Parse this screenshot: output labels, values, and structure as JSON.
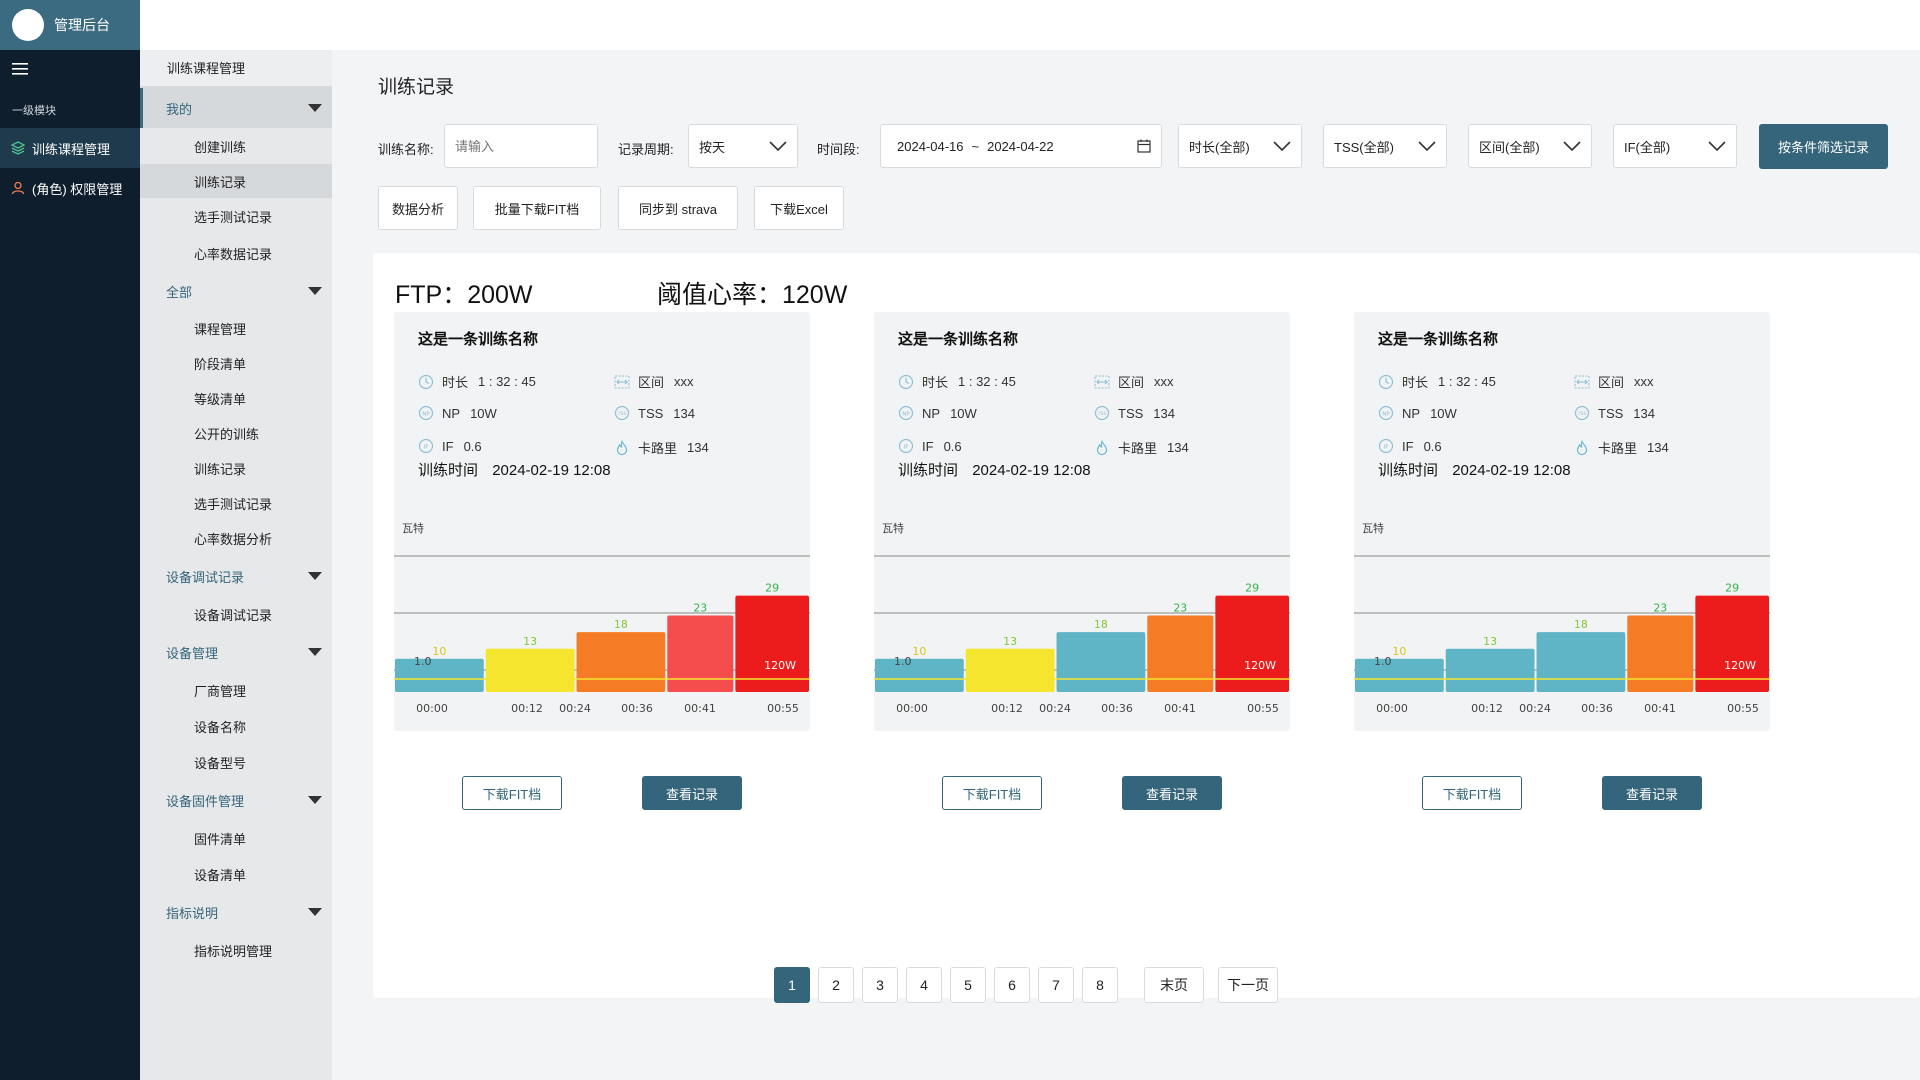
{
  "app": {
    "title": "管理后台"
  },
  "rail": {
    "section_label": "一级模块",
    "items": [
      {
        "label": "训练课程管理",
        "icon": "layers-icon",
        "active": true
      },
      {
        "label": "(角色) 权限管理",
        "icon": "user-icon",
        "active": false
      }
    ]
  },
  "submenu": {
    "header": "训练课程管理",
    "groups": [
      {
        "label": "我的",
        "items": [
          "创建训练",
          "训练记录",
          "选手测试记录",
          "心率数据记录"
        ]
      },
      {
        "label": "全部",
        "items": [
          "课程管理",
          "阶段清单",
          "等级清单",
          "公开的训练",
          "训练记录",
          "选手测试记录",
          "心率数据分析"
        ]
      },
      {
        "label": "设备调试记录",
        "items": [
          "设备调试记录"
        ]
      },
      {
        "label": "设备管理",
        "items": [
          "厂商管理",
          "设备名称",
          "设备型号"
        ]
      },
      {
        "label": "设备固件管理",
        "items": [
          "固件清单",
          "设备清单"
        ]
      },
      {
        "label": "指标说明",
        "items": [
          "指标说明管理"
        ]
      }
    ]
  },
  "page": {
    "title": "训练记录"
  },
  "filters": {
    "name_label": "训练名称:",
    "name_placeholder": "请输入",
    "period_label": "记录周期:",
    "period_value": "按天",
    "range_label": "时间段:",
    "range_start": "2024-04-16",
    "range_sep": "~",
    "range_end": "2024-04-22",
    "duration": "时长(全部)",
    "tss": "TSS(全部)",
    "zone": "区间(全部)",
    "if": "IF(全部)",
    "submit": "按条件筛选记录"
  },
  "actions": [
    "数据分析",
    "批量下载FIT档",
    "同步到 strava",
    "下载Excel"
  ],
  "summary": {
    "ftp": "FTP：200W",
    "hr_threshold": "阈值心率：120W"
  },
  "cards": [
    {
      "title": "这是一条训练名称",
      "duration_label": "时长",
      "duration": "1 : 32 : 45",
      "zone_label": "区间",
      "zone": "xxx",
      "np_label": "NP",
      "np": "10W",
      "tss_label": "TSS",
      "tss": "134",
      "if_label": "IF",
      "if": "0.6",
      "cal_label": "卡路里",
      "cal": "134",
      "time_label": "训练时间",
      "time": "2024-02-19  12:08",
      "unit": "瓦特",
      "btn_download": "下载FIT档",
      "btn_view": "查看记录"
    },
    {
      "title": "这是一条训练名称",
      "duration_label": "时长",
      "duration": "1 : 32 : 45",
      "zone_label": "区间",
      "zone": "xxx",
      "np_label": "NP",
      "np": "10W",
      "tss_label": "TSS",
      "tss": "134",
      "if_label": "IF",
      "if": "0.6",
      "cal_label": "卡路里",
      "cal": "134",
      "time_label": "训练时间",
      "time": "2024-02-19  12:08",
      "unit": "瓦特",
      "btn_download": "下载FIT档",
      "btn_view": "查看记录"
    },
    {
      "title": "这是一条训练名称",
      "duration_label": "时长",
      "duration": "1 : 32 : 45",
      "zone_label": "区间",
      "zone": "xxx",
      "np_label": "NP",
      "np": "10W",
      "tss_label": "TSS",
      "tss": "134",
      "if_label": "IF",
      "if": "0.6",
      "cal_label": "卡路里",
      "cal": "134",
      "time_label": "训练时间",
      "time": "2024-02-19  12:08",
      "unit": "瓦特",
      "btn_download": "下载FIT档",
      "btn_view": "查看记录"
    }
  ],
  "chart_data": [
    {
      "type": "bar",
      "x_ticks": [
        "00:00",
        "00:12",
        "00:24",
        "00:36",
        "00:41",
        "00:55"
      ],
      "segments": [
        {
          "start": 0,
          "end": 12,
          "value": 10,
          "color": "#5fb5c6"
        },
        {
          "start": 12,
          "end": 24,
          "value": 13,
          "color": "#f5e52e"
        },
        {
          "start": 24,
          "end": 36,
          "value": 18,
          "color": "#f57b25"
        },
        {
          "start": 36,
          "end": 45,
          "value": 23,
          "color": "#f54d4d"
        },
        {
          "start": 45,
          "end": 55,
          "value": 29,
          "color": "#ec1c1c"
        }
      ],
      "value_label_colors": [
        "#d9c41f",
        "#7ecb3a",
        "#7ecb3a",
        "#36b54a",
        "#36b54a"
      ],
      "reference_line_label": "1.0",
      "threshold_label": "120W",
      "ylim": [
        0,
        90
      ]
    },
    {
      "type": "bar",
      "x_ticks": [
        "00:00",
        "00:12",
        "00:24",
        "00:36",
        "00:41",
        "00:55"
      ],
      "segments": [
        {
          "start": 0,
          "end": 12,
          "value": 10,
          "color": "#5fb5c6"
        },
        {
          "start": 12,
          "end": 24,
          "value": 13,
          "color": "#f5e52e"
        },
        {
          "start": 24,
          "end": 36,
          "value": 18,
          "color": "#5fb5c6"
        },
        {
          "start": 36,
          "end": 45,
          "value": 23,
          "color": "#f57b25"
        },
        {
          "start": 45,
          "end": 55,
          "value": 29,
          "color": "#ec1c1c"
        }
      ],
      "value_label_colors": [
        "#d9c41f",
        "#7ecb3a",
        "#7ecb3a",
        "#36b54a",
        "#36b54a"
      ],
      "reference_line_label": "1.0",
      "threshold_label": "120W",
      "ylim": [
        0,
        90
      ]
    },
    {
      "type": "bar",
      "x_ticks": [
        "00:00",
        "00:12",
        "00:24",
        "00:36",
        "00:41",
        "00:55"
      ],
      "segments": [
        {
          "start": 0,
          "end": 12,
          "value": 10,
          "color": "#5fb5c6"
        },
        {
          "start": 12,
          "end": 24,
          "value": 13,
          "color": "#5fb5c6"
        },
        {
          "start": 24,
          "end": 36,
          "value": 18,
          "color": "#5fb5c6"
        },
        {
          "start": 36,
          "end": 45,
          "value": 23,
          "color": "#f57b25"
        },
        {
          "start": 45,
          "end": 55,
          "value": 29,
          "color": "#ec1c1c"
        }
      ],
      "value_label_colors": [
        "#d9c41f",
        "#7ecb3a",
        "#7ecb3a",
        "#36b54a",
        "#36b54a"
      ],
      "reference_line_label": "1.0",
      "threshold_label": "120W",
      "ylim": [
        0,
        90
      ]
    }
  ],
  "pagination": {
    "pages": [
      "1",
      "2",
      "3",
      "4",
      "5",
      "6",
      "7",
      "8"
    ],
    "current": "1",
    "last": "末页",
    "next": "下一页"
  }
}
